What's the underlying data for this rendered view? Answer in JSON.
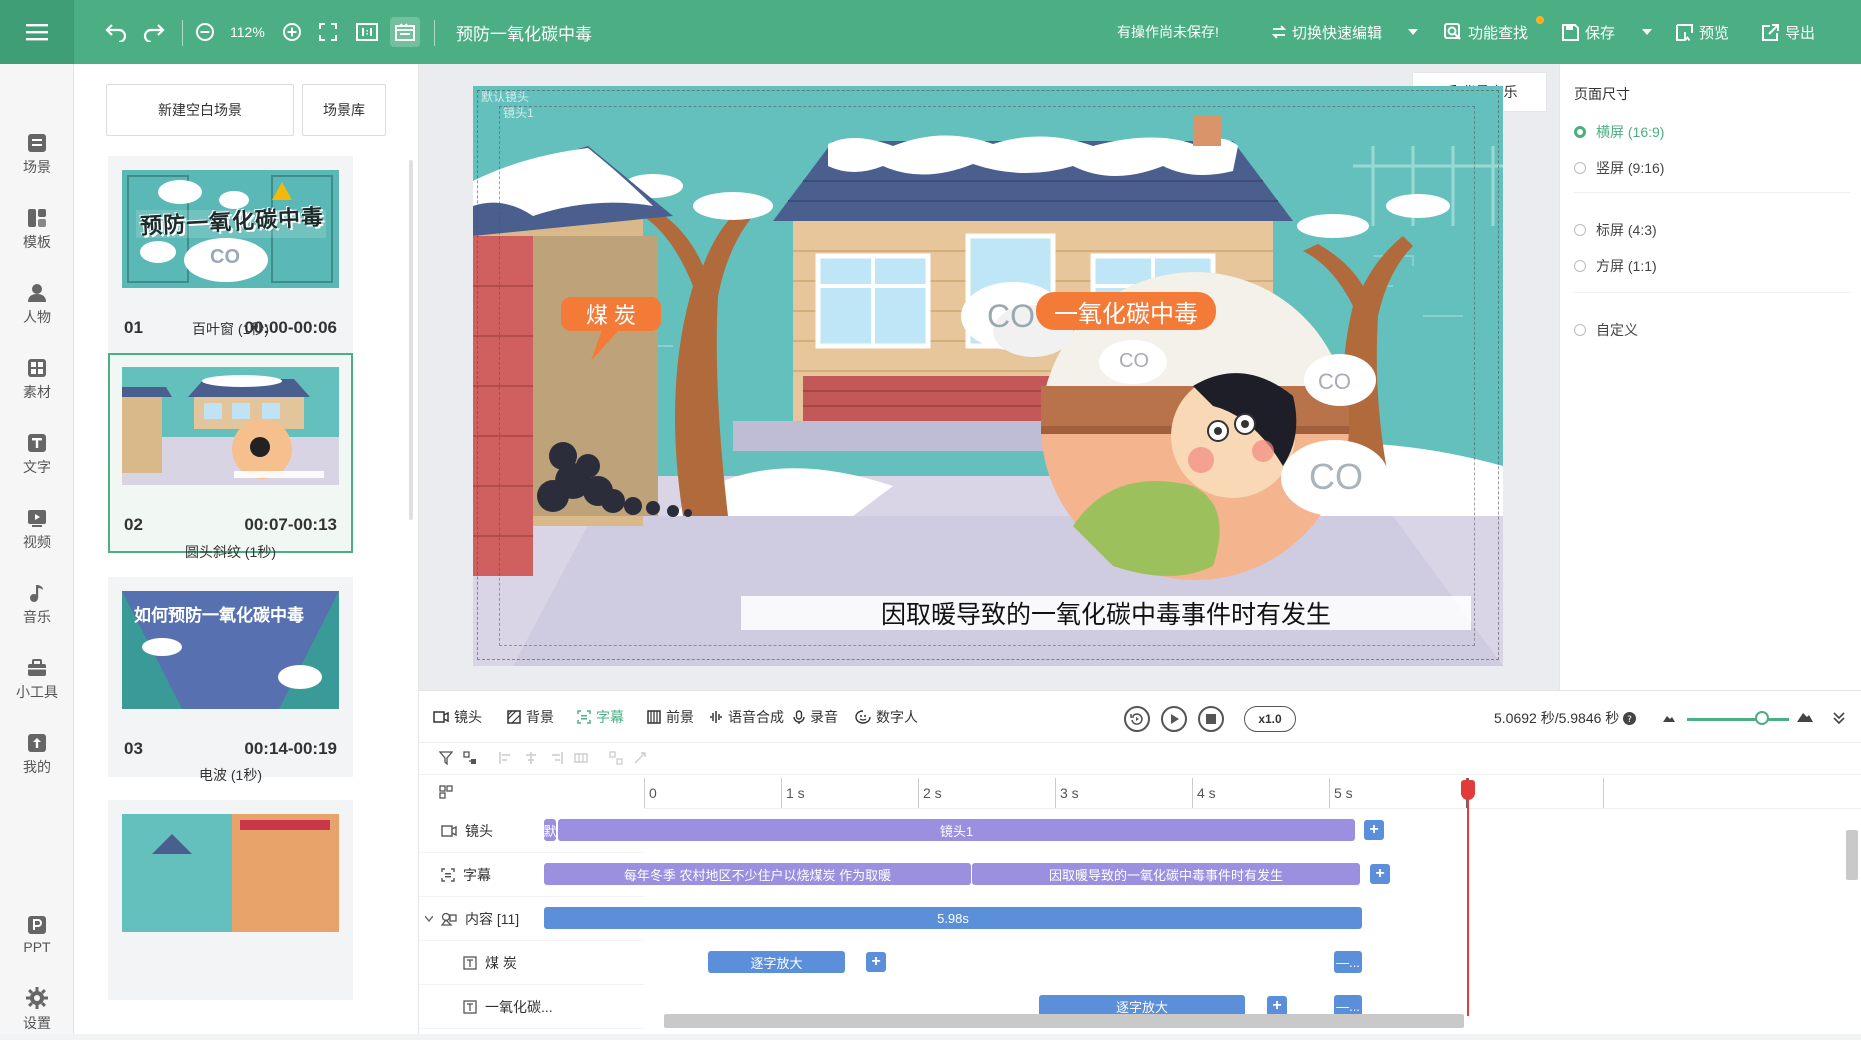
{
  "topbar": {
    "zoom": "112%",
    "title": "预防一氧化碳中毒",
    "unsaved_notice": "有操作尚未保存!",
    "quick_edit": "切换快速编辑",
    "feature_search": "功能查找",
    "save": "保存",
    "preview": "预览",
    "export": "导出",
    "colors": {
      "bar": "#4caf84",
      "accent": "#4caf84"
    }
  },
  "nav": {
    "items": [
      {
        "label": "场景",
        "icon": "scene-icon"
      },
      {
        "label": "模板",
        "icon": "template-icon"
      },
      {
        "label": "人物",
        "icon": "person-icon"
      },
      {
        "label": "素材",
        "icon": "material-icon"
      },
      {
        "label": "文字",
        "icon": "text-icon"
      },
      {
        "label": "视频",
        "icon": "video-icon"
      },
      {
        "label": "音乐",
        "icon": "music-icon"
      },
      {
        "label": "小工具",
        "icon": "toolbox-icon"
      },
      {
        "label": "我的",
        "icon": "upload-icon"
      },
      {
        "label": "PPT",
        "icon": "ppt-icon"
      },
      {
        "label": "设置",
        "icon": "gear-icon"
      }
    ]
  },
  "scenes": {
    "new_blank": "新建空白场景",
    "library": "场景库",
    "cards": [
      {
        "num": "01",
        "time": "00:00-00:06",
        "thumb_title": "预防一氧化碳中毒",
        "transition": "百叶窗 (1秒)"
      },
      {
        "num": "02",
        "time": "00:07-00:13",
        "transition": "圆头斜纹 (1秒)"
      },
      {
        "num": "03",
        "time": "00:14-00:19",
        "thumb_title": "如何预防一氧化碳中毒",
        "transition": "电波 (1秒)"
      }
    ],
    "thumb_co": "CO"
  },
  "stage": {
    "coal_label": "煤 炭",
    "co_label": "一氧化碳中毒",
    "co_text": "CO",
    "caption": "因取暖导致的一氧化碳中毒事件时有发生",
    "camera_label_1": "默认镜头",
    "camera_label_2": "镜头1"
  },
  "bgm": "背景音乐",
  "page_size": {
    "title": "页面尺寸",
    "options": [
      {
        "label": "横屏 (16:9)",
        "selected": true
      },
      {
        "label": "竖屏 (9:16)",
        "selected": false
      },
      {
        "label": "标屏 (4:3)",
        "selected": false
      },
      {
        "label": "方屏 (1:1)",
        "selected": false
      },
      {
        "label": "自定义",
        "selected": false
      }
    ]
  },
  "timeline": {
    "tabs": [
      "镜头",
      "背景",
      "字幕",
      "前景",
      "语音合成",
      "录音",
      "数字人"
    ],
    "active_tab": "字幕",
    "speed": "x1.0",
    "time": "5.0692 秒/5.9846 秒",
    "zoom_level": 0.55,
    "ruler": [
      "0",
      "1 s",
      "2 s",
      "3 s",
      "4 s",
      "5 s"
    ],
    "tracks": [
      {
        "label": "镜头"
      },
      {
        "label": "字幕"
      },
      {
        "label": "内容 [11]"
      },
      {
        "label": "煤 炭"
      },
      {
        "label": "一氧化碳..."
      }
    ],
    "bars": {
      "camera_default": "默",
      "camera_1": "镜头1",
      "sub_1": "每年冬季 农村地区不少住户以烧煤炭 作为取暖",
      "sub_2": "因取暖导致的一氧化碳中毒事件时有发生",
      "content": "5.98s",
      "coal_effect": "逐字放大",
      "co_effect": "逐字放大",
      "tail": "—..."
    },
    "plus": "+"
  }
}
